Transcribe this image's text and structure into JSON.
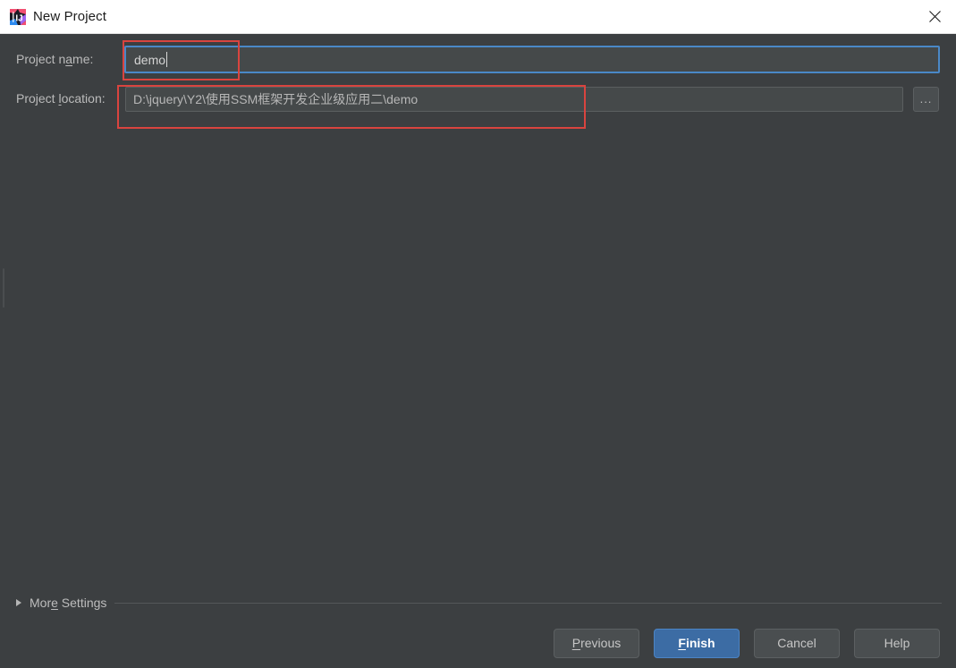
{
  "window": {
    "title": "New Project",
    "app_icon": "intellij-idea-icon",
    "close_icon": "close-icon"
  },
  "form": {
    "project_name": {
      "label": "Project name:",
      "label_mnemonic": "a",
      "value": "demo",
      "placeholder": "",
      "focused": true
    },
    "project_location": {
      "label": "Project location:",
      "label_mnemonic": "l",
      "value": "D:\\jquery\\Y2\\使用SSM框架开发企业级应用二\\demo",
      "placeholder": "",
      "browse_button_label": "..."
    }
  },
  "more_settings": {
    "label": "More Settings",
    "label_mnemonic": "e",
    "expanded": false,
    "arrow_icon": "triangle-right-icon"
  },
  "buttons": {
    "previous": "Previous",
    "finish": "Finish",
    "cancel": "Cancel",
    "help": "Help"
  },
  "colors": {
    "dialog_background": "#3c3f41",
    "titlebar_background": "#ffffff",
    "field_background": "#45494a",
    "focus_border": "#4a88c7",
    "primary_button": "#3c6ca4",
    "annotation_red": "#d9443f",
    "text_primary": "#bbbbbb"
  }
}
